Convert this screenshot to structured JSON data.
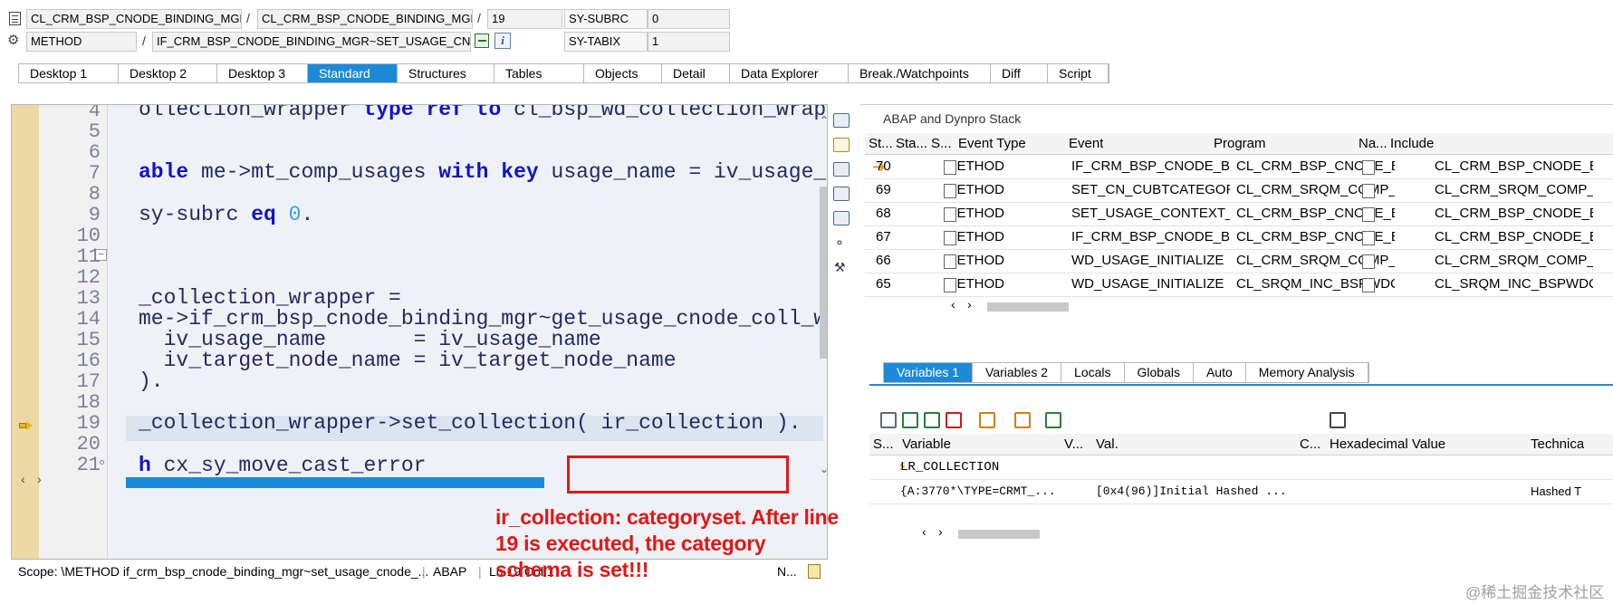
{
  "header": {
    "row1": {
      "field1": "CL_CRM_BSP_CNODE_BINDING_MGR=...",
      "sep1": "/",
      "field2": "CL_CRM_BSP_CNODE_BINDING_MGR=...",
      "sep2": "/",
      "field3": "19",
      "sysvar_name": "SY-SUBRC",
      "sysvar_value": "0"
    },
    "row2": {
      "field1": "METHOD",
      "sep1": "/",
      "field2": "IF_CRM_BSP_CNODE_BINDING_MGR~SET_USAGE_CNO...",
      "sysvar_name": "SY-TABIX",
      "sysvar_value": "1"
    }
  },
  "tabs": [
    "Desktop 1",
    "Desktop 2",
    "Desktop 3",
    "Standard",
    "Structures",
    "Tables",
    "Objects",
    "Detail",
    "Data Explorer",
    "Break./Watchpoints",
    "Diff",
    "Script"
  ],
  "active_tab": "Standard",
  "editor": {
    "lines": [
      {
        "n": "4",
        "parts": [
          [
            "ollection_wrapper ",
            ""
          ],
          [
            "type",
            ""
          ],
          [
            " ",
            ""
          ],
          [
            "ref",
            ""
          ],
          [
            " ",
            ""
          ],
          [
            "to",
            ""
          ],
          [
            " cl_bsp_wd_collection_wrap",
            ""
          ]
        ]
      },
      {
        "n": "5"
      },
      {
        "n": "6"
      },
      {
        "n": "7"
      },
      {
        "n": "8"
      },
      {
        "n": "9"
      },
      {
        "n": "10"
      },
      {
        "n": "11"
      },
      {
        "n": "12"
      },
      {
        "n": "13"
      },
      {
        "n": "14"
      },
      {
        "n": "15"
      },
      {
        "n": "16"
      },
      {
        "n": "17"
      },
      {
        "n": "18"
      },
      {
        "n": "19"
      },
      {
        "n": "20"
      },
      {
        "n": "21"
      }
    ],
    "code": {
      "l4a": "ollection_wrapper ",
      "l4k1": "type",
      "l4k2": "ref",
      "l4k3": "to",
      "l4b": " cl_bsp_wd_collection_wrap",
      "l7k1": "able",
      "l7a": " me->mt_comp_usages ",
      "l7k2": "with",
      "l7k3": "key",
      "l7b": " usage_name = iv_usage_",
      "l9a": "sy-subrc ",
      "l9k": "eq",
      "l9n": " 0",
      "l9b": ".",
      "l13": "_collection_wrapper =",
      "l14": "me->if_crm_bsp_cnode_binding_mgr~get_usage_cnode_coll_w",
      "l15": "  iv_usage_name       = iv_usage_name",
      "l16": "  iv_target_node_name = iv_target_node_name",
      "l17": ").",
      "l19": "_collection_wrapper->set_collection( ir_collection ).",
      "l21k": "h",
      "l21": " cx_sy_move_cast_error"
    }
  },
  "status": {
    "scope": "Scope: \\METHOD if_crm_bsp_cnode_binding_mgr~set_usage_cnode_...",
    "lang": "ABAP",
    "pos": "Ln  19 Col  1",
    "mode": "N..."
  },
  "annotation": "ir_collection: categoryset. After line 19 is executed, the category schema is set!!!",
  "stack": {
    "title": "ABAP and Dynpro Stack",
    "columns": [
      "St...",
      "Sta...",
      "S...",
      "Event Type",
      "Event",
      "Program",
      "Na...",
      "Include"
    ],
    "rows": [
      {
        "sta": "70",
        "type": "METHOD",
        "event": "IF_CRM_BSP_CNODE_BI...",
        "program": "CL_CRM_BSP_CNODE_BI...",
        "include": "CL_CRM_BSP_CNODE_B",
        "current": true
      },
      {
        "sta": "69",
        "type": "METHOD",
        "event": "SET_CN_CUBTCATEGOR...",
        "program": "CL_CRM_SRQM_COMP_C...",
        "include": "CL_CRM_SRQM_COMP_C",
        "current": false
      },
      {
        "sta": "68",
        "type": "METHOD",
        "event": "SET_USAGE_CONTEXT_...",
        "program": "CL_CRM_BSP_CNODE_BI...",
        "include": "CL_CRM_BSP_CNODE_B",
        "current": false
      },
      {
        "sta": "67",
        "type": "METHOD",
        "event": "IF_CRM_BSP_CNODE_BI...",
        "program": "CL_CRM_BSP_CNODE_BI...",
        "include": "CL_CRM_BSP_CNODE_B",
        "current": false
      },
      {
        "sta": "66",
        "type": "METHOD",
        "event": "WD_USAGE_INITIALIZE",
        "program": "CL_CRM_SRQM_COMP_C...",
        "include": "CL_CRM_SRQM_COMP_C",
        "current": false
      },
      {
        "sta": "65",
        "type": "METHOD",
        "event": "WD_USAGE_INITIALIZE",
        "program": "CL_SRQM_INC_BSPWDC...",
        "include": "CL_SRQM_INC_BSPWDC",
        "current": false
      }
    ]
  },
  "vars": {
    "tabs": [
      "Variables 1",
      "Variables 2",
      "Locals",
      "Globals",
      "Auto",
      "Memory Analysis"
    ],
    "active_tab": "Variables 1",
    "columns": [
      "S...",
      "Variable",
      "V...",
      "Val.",
      "C...",
      "Hexadecimal Value",
      "Technica"
    ],
    "rows": [
      {
        "variable": "LR_COLLECTION",
        "value": "",
        "tech": ""
      },
      {
        "variable": "{A:3770*\\TYPE=CRMT_...",
        "value": "[0x4(96)]Initial Hashed ...",
        "tech": "Hashed T"
      }
    ]
  },
  "watermark": "@稀土掘金技术社区",
  "colors": {
    "accent": "#1c8ad8",
    "annotation": "#e01818",
    "breakpoint_col": "#ecd9a6"
  }
}
